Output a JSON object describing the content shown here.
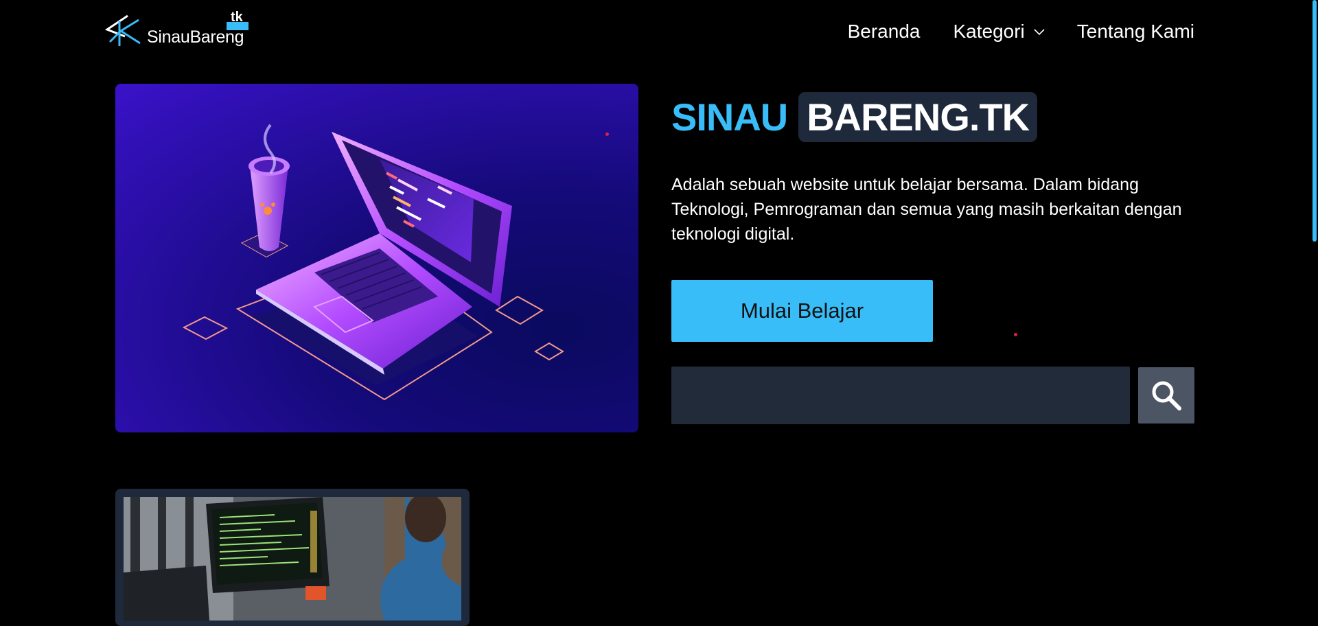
{
  "header": {
    "logo_text": "SinauBareng",
    "logo_badge": "tk",
    "nav": [
      {
        "label": "Beranda"
      },
      {
        "label": "Kategori"
      },
      {
        "label": "Tentang Kami"
      }
    ]
  },
  "hero": {
    "title_part1": "SINAU",
    "title_part2": "BARENG.TK",
    "description": "Adalah sebuah website untuk belajar bersama. Dalam bidang Teknologi, Pemrograman dan semua yang masih berkaitan dengan teknologi digital.",
    "cta_label": "Mulai Belajar",
    "search": {
      "value": "",
      "placeholder": ""
    }
  },
  "icons": {
    "logo": "sk-logo-icon",
    "dropdown": "chevron-down-icon",
    "search": "search-icon"
  },
  "colors": {
    "accent": "#38bdf8",
    "background": "#000000",
    "panel": "#1e293b",
    "search_button": "#4b5563"
  }
}
